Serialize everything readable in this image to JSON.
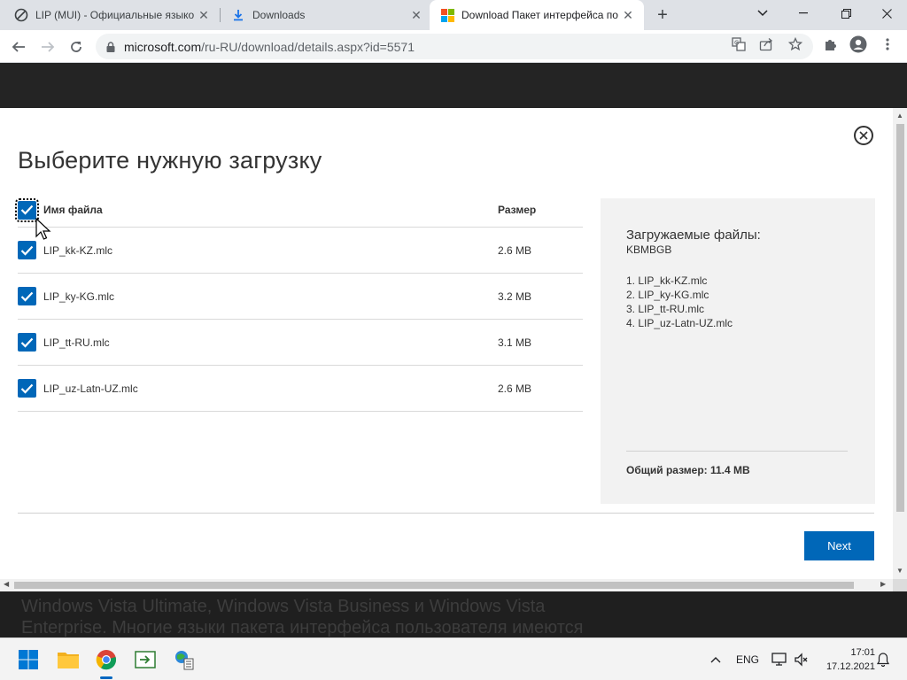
{
  "browser": {
    "tabs": [
      {
        "title": "LIP (MUI) - Официальные языко",
        "favicon": "globe-icon",
        "active": false
      },
      {
        "title": "Downloads",
        "favicon": "download-icon",
        "active": false
      },
      {
        "title": "Download Пакет интерфейса по",
        "favicon": "microsoft-logo-icon",
        "active": true
      }
    ],
    "new_tab_label": "+",
    "url_host": "microsoft.com",
    "url_path": "/ru-RU/download/details.aspx?id=5571"
  },
  "dialog": {
    "title": "Выберите нужную загрузку",
    "close_label": "×",
    "table": {
      "col_name": "Имя файла",
      "col_size": "Размер",
      "rows": [
        {
          "name": "LIP_kk-KZ.mlc",
          "size": "2.6 MB",
          "checked": true
        },
        {
          "name": "LIP_ky-KG.mlc",
          "size": "3.2 MB",
          "checked": true
        },
        {
          "name": "LIP_tt-RU.mlc",
          "size": "3.1 MB",
          "checked": true
        },
        {
          "name": "LIP_uz-Latn-UZ.mlc",
          "size": "2.6 MB",
          "checked": true
        }
      ]
    },
    "summary": {
      "title": "Загружаемые файлы:",
      "kb": "KBMBGB",
      "items": [
        "1. LIP_kk-KZ.mlc",
        "2. LIP_ky-KG.mlc",
        "3. LIP_tt-RU.mlc",
        "4. LIP_uz-Latn-UZ.mlc"
      ],
      "total": "Общий размер: 11.4 MB"
    },
    "next_label": "Next"
  },
  "background_text": {
    "line1": "Windows Vista Ultimate, Windows Vista Business и Windows Vista",
    "line2": "Enterprise. Многие языки пакета интерфейса пользователя имеются"
  },
  "taskbar": {
    "lang": "ENG",
    "time": "17:01",
    "date": "17.12.2021"
  },
  "colors": {
    "accent": "#0067b8",
    "banner": "#242424",
    "summary_bg": "#f2f2f2"
  }
}
